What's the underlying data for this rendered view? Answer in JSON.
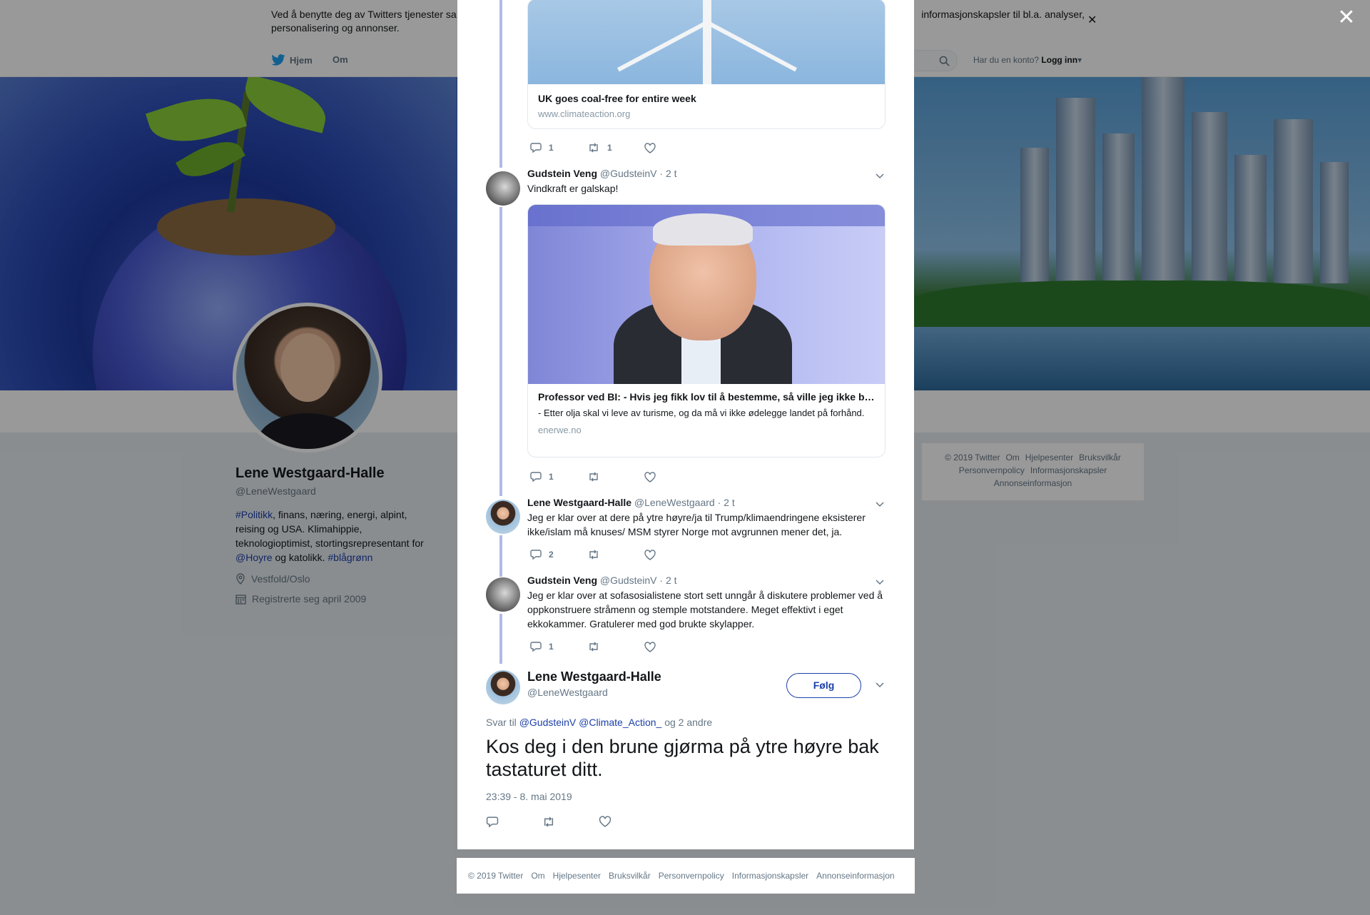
{
  "cookie": {
    "text": "Ved å benytte deg av Twitters tjenester sa                                                                                                                                               informasjonskapsler til bl.a. analyser, personalisering og annonser.",
    "text_left": "Ved å benytte deg av Twitters tjenester sa",
    "text_right": "informasjonskapsler til bl.a. analyser,",
    "text_line2": "personalisering og annonser."
  },
  "nav": {
    "home": "Hjem",
    "about": "Om",
    "login_question": "Har du en konto?",
    "login": "Logg inn"
  },
  "profile": {
    "name": "Lene Westgaard-Halle",
    "handle": "@LeneWestgaard",
    "bio_parts": {
      "tag1": "#Politikk",
      "text1": ", finans, næring, energi, alpint, reising og USA. Klimahippie, teknologioptimist, stortingsrepresentant for ",
      "mention": "@Hoyre",
      "text2": " og katolikk. ",
      "tag2": "#blågrønn"
    },
    "location": "Vestfold/Oslo",
    "joined": "Registrerte seg april 2009"
  },
  "side_footer": {
    "line1": [
      "© 2019 Twitter",
      "Om",
      "Hjelpesenter",
      "Bruksvilkår"
    ],
    "line2": [
      "Personvernpolicy",
      "Informasjonskapsler"
    ],
    "line3": [
      "Annonseinformasjon"
    ]
  },
  "thread": {
    "card1": {
      "title": "UK goes coal-free for entire week",
      "url": "www.climateaction.org"
    },
    "card1_actions": {
      "replies": "1",
      "retweets": "1"
    },
    "tweet2": {
      "name": "Gudstein Veng",
      "handle": "@GudsteinV",
      "time": "· 2 t",
      "text": "Vindkraft er galskap!",
      "card_title": "Professor ved BI: - Hvis jeg fikk lov til å bestemme, så ville jeg ikke bygget ut mer vindkraft",
      "card_desc": "- Etter olja skal vi leve av turisme, og da må vi ikke ødelegge landet på forhånd.",
      "card_url": "enerwe.no",
      "replies": "1"
    },
    "tweet3": {
      "name": "Lene Westgaard-Halle",
      "handle": "@LeneWestgaard",
      "time": "· 2 t",
      "text": "Jeg er klar over at dere på ytre høyre/ja til Trump/klimaendringene eksisterer ikke/islam må knuses/ MSM styrer Norge mot avgrunnen mener det, ja.",
      "replies": "2"
    },
    "tweet4": {
      "name": "Gudstein Veng",
      "handle": "@GudsteinV",
      "time": "· 2 t",
      "text": "Jeg er klar over at sofasosialistene stort sett unngår å diskutere problemer ved å oppkonstruere stråmenn og stemple motstandere. Meget effektivt i eget ekkokammer. Gratulerer med god brukte skylapper.",
      "replies": "1"
    }
  },
  "focus": {
    "name": "Lene Westgaard-Halle",
    "handle": "@LeneWestgaard",
    "follow": "Følg",
    "reply_prefix": "Svar til",
    "reply_m1": "@GudsteinV",
    "reply_m2": "@Climate_Action_",
    "reply_suffix": "og 2 andre",
    "text": "Kos deg i den brune gjørma på ytre høyre bak tastaturet ditt.",
    "timestamp": "23:39 - 8. mai 2019"
  },
  "modal_footer": [
    "© 2019 Twitter",
    "Om",
    "Hjelpesenter",
    "Bruksvilkår",
    "Personvernpolicy",
    "Informasjonskapsler",
    "Annonseinformasjon"
  ],
  "colors": {
    "link": "#1b3fa8",
    "thread_line": "#b3b8e6",
    "muted": "#657786"
  }
}
